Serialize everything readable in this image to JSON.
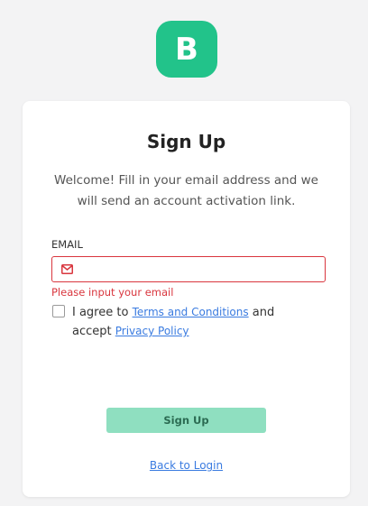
{
  "logo": {
    "letter": "B"
  },
  "form": {
    "title": "Sign Up",
    "subtitle": "Welcome! Fill in your email address and we will send an account activation link.",
    "email_label": "EMAIL",
    "email_value": "",
    "email_placeholder": "",
    "email_error": "Please input your email",
    "agree_prefix": "I agree to ",
    "terms_link": "Terms and Conditions",
    "agree_middle": " and accept ",
    "privacy_link": "Privacy Policy",
    "submit_label": "Sign Up",
    "back_link": "Back to Login"
  },
  "colors": {
    "brand": "#22c38a",
    "button_disabled": "#8fdfc0",
    "error": "#d9363e",
    "link": "#3a7be0"
  }
}
